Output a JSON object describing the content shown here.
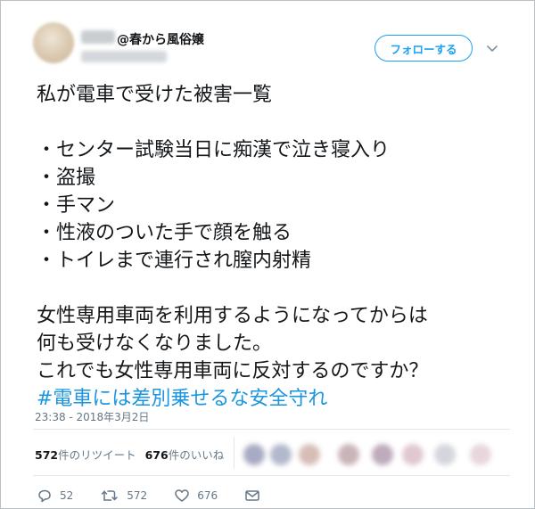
{
  "user": {
    "display_name": "@春から風俗嬢"
  },
  "follow_button": {
    "label": "フォローする"
  },
  "tweet": {
    "lines": [
      "私が電車で受けた被害一覧",
      "・センター試験当日に痴漢で泣き寝入り",
      "・盗撮",
      "・手マン",
      "・性液のついた手で顔を触る",
      "・トイレまで連行され膣内射精",
      "女性専用車両を利用するようになってからは",
      "何も受けなくなりました。",
      "これでも女性専用車両に反対するのですか？"
    ],
    "hashtag": "#電車には差別乗せるな安全守れ"
  },
  "timestamp": "23:38 - 2018年3月2日",
  "stats": {
    "retweet_count": "572",
    "retweet_label": "件のリツイート",
    "like_count": "676",
    "like_label": "件のいいね"
  },
  "actions": {
    "reply_count": "52",
    "retweet_count": "572",
    "like_count": "676"
  },
  "colors": {
    "accent": "#1da1f2",
    "hashtag": "#1b95e0",
    "muted": "#657786"
  }
}
